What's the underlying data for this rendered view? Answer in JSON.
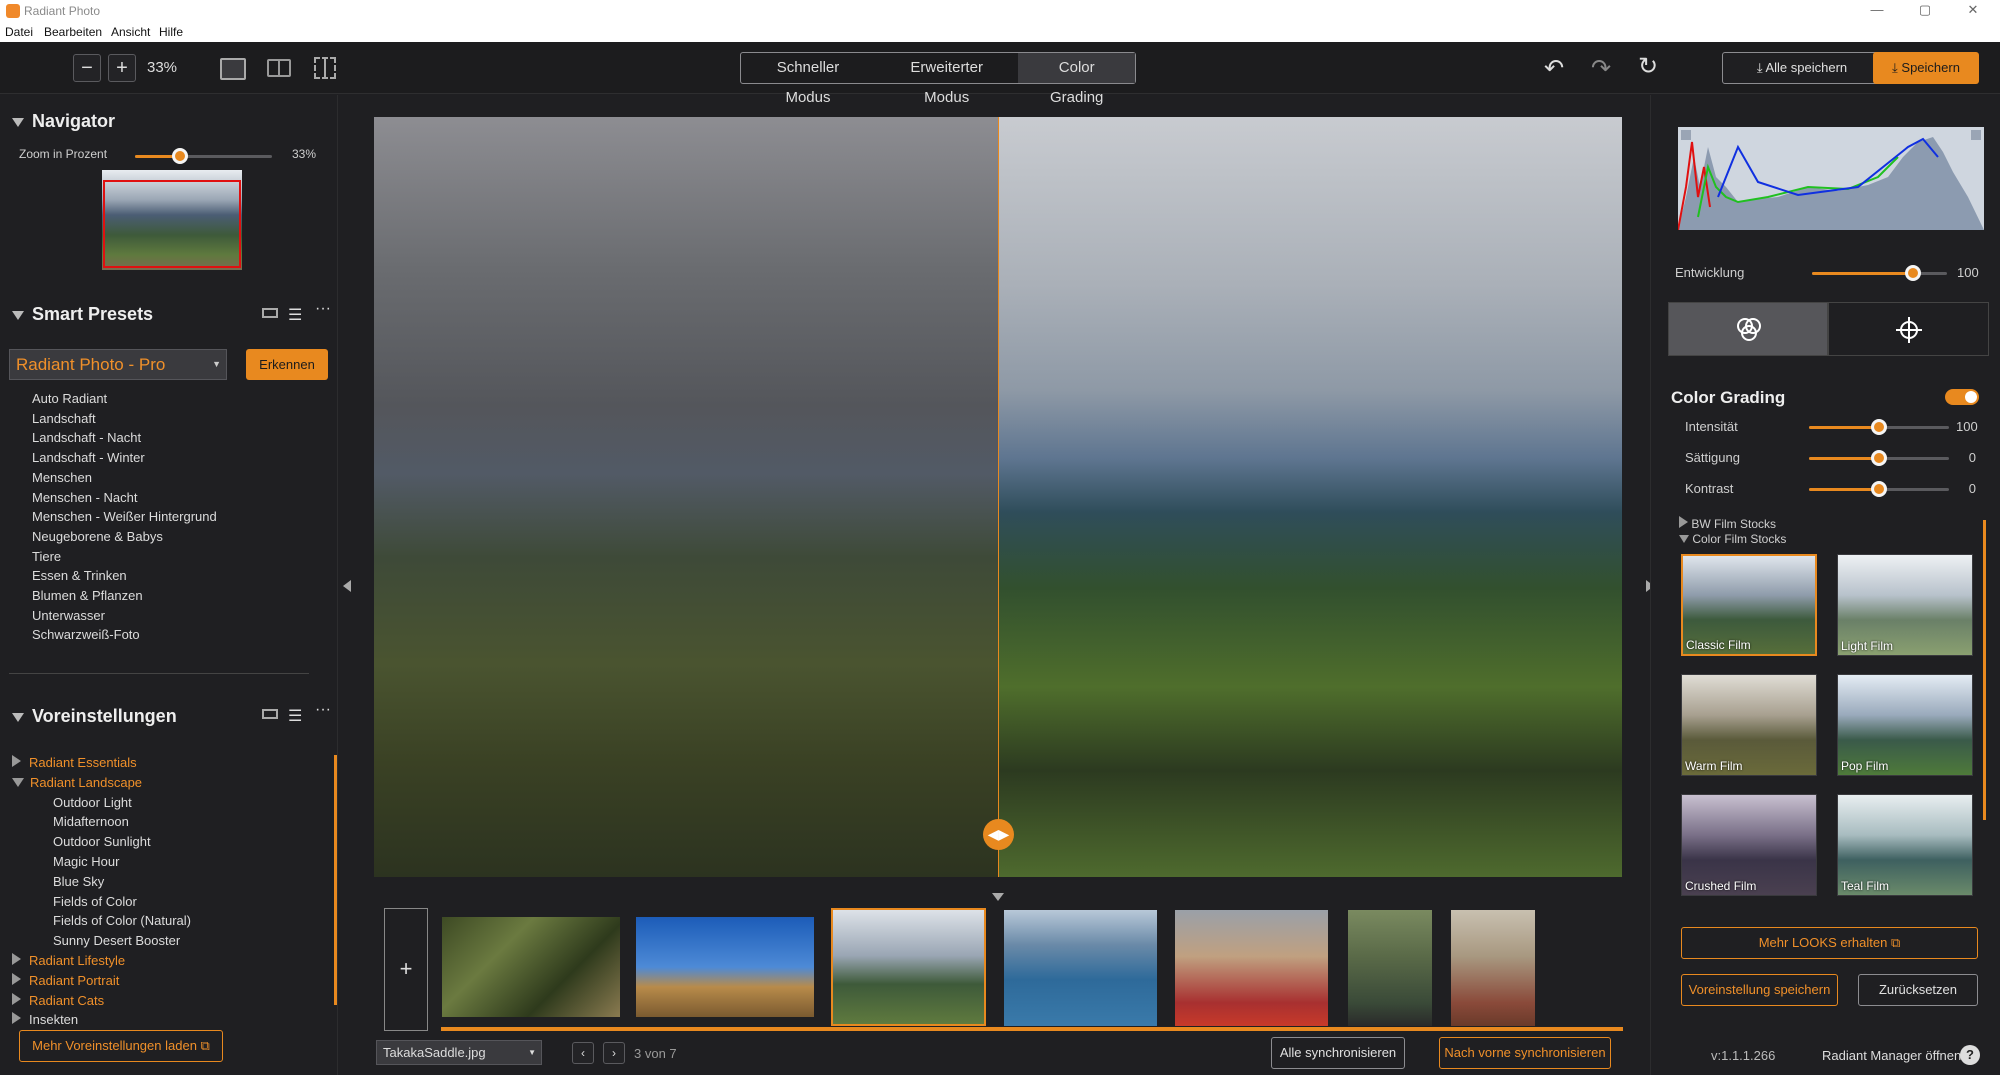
{
  "app": {
    "title": "Radiant Photo"
  },
  "menu": [
    "Datei",
    "Bearbeiten",
    "Ansicht",
    "Hilfe"
  ],
  "toolbar": {
    "zoom": "33%",
    "modes": [
      "Schneller Modus",
      "Erweiterter Modus",
      "Color Grading"
    ],
    "active_mode": "Color Grading",
    "save_all": "Alle speichern",
    "save": "Speichern"
  },
  "navigator": {
    "title": "Navigator",
    "zoom_label": "Zoom in Prozent",
    "zoom_value": "33%",
    "zoom_level": 0.33
  },
  "smart_presets": {
    "title": "Smart Presets",
    "selected": "Radiant Photo - Pro",
    "detect_button": "Erkennen",
    "items": [
      "Auto Radiant",
      "Landschaft",
      "Landschaft - Nacht",
      "Landschaft - Winter",
      "Menschen",
      "Menschen - Nacht",
      "Menschen - Weißer Hintergrund",
      "Neugeborene & Babys",
      "Tiere",
      "Essen & Trinken",
      "Blumen & Pflanzen",
      "Unterwasser",
      "Schwarzweiß-Foto"
    ]
  },
  "presets": {
    "title": "Voreinstellungen",
    "groups": [
      {
        "label": "Radiant Essentials",
        "expanded": false
      },
      {
        "label": "Radiant Landscape",
        "expanded": true,
        "children": [
          "Outdoor Light",
          "Midafternoon",
          "Outdoor Sunlight",
          "Magic Hour",
          "Blue Sky",
          "Fields of Color",
          "Fields of Color (Natural)",
          "Sunny Desert Booster"
        ]
      },
      {
        "label": "Radiant Lifestyle",
        "expanded": false
      },
      {
        "label": "Radiant Portrait",
        "expanded": false
      },
      {
        "label": "Radiant Cats",
        "expanded": false
      },
      {
        "label": "Insekten",
        "expanded": false
      }
    ],
    "more_button": "Mehr Voreinstellungen laden"
  },
  "filmstrip": {
    "filename": "TakakaSaddle.jpg",
    "counter": "3 von 7",
    "sync_all": "Alle synchronisieren",
    "sync_forward": "Nach vorne synchronisieren",
    "add": "+"
  },
  "right": {
    "development_label": "Entwicklung",
    "development_value": "100",
    "development_level": 0.75,
    "color_grading": {
      "title": "Color Grading",
      "enabled": true,
      "sliders": [
        {
          "label": "Intensität",
          "value": "100",
          "level": 0.5
        },
        {
          "label": "Sättigung",
          "value": "0",
          "level": 0.5
        },
        {
          "label": "Kontrast",
          "value": "0",
          "level": 0.5
        }
      ]
    },
    "stocks": [
      {
        "label": "BW Film Stocks",
        "expanded": false
      },
      {
        "label": "Color Film Stocks",
        "expanded": true
      }
    ],
    "looks": [
      "Classic Film",
      "Light Film",
      "Warm Film",
      "Pop Film",
      "Crushed Film",
      "Teal Film"
    ],
    "selected_look": "Classic Film",
    "more_looks": "Mehr LOOKS erhalten",
    "save_preset": "Voreinstellung speichern",
    "reset": "Zurücksetzen",
    "version": "v:1.1.1.266",
    "manager": "Radiant Manager öffnen",
    "help": "?"
  },
  "colors": {
    "accent": "#e8891f",
    "bg": "#1f1f22"
  }
}
